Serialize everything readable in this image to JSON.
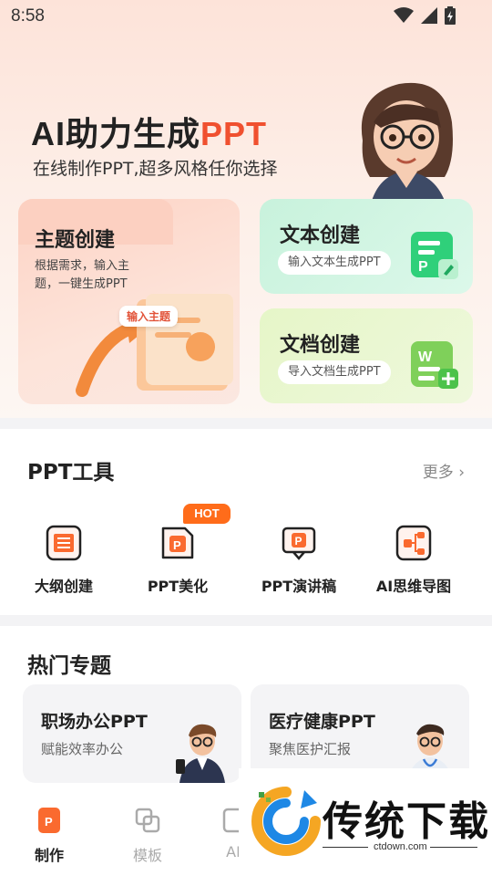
{
  "status_bar": {
    "time": "8:58"
  },
  "hero": {
    "title_prefix": "AI助力生成",
    "title_accent": "PPT",
    "subtitle": "在线制作PPT,超多风格任你选择"
  },
  "create_cards": {
    "theme": {
      "title": "主题创建",
      "description": "根据需求，输入主题，一键生成PPT",
      "tag": "输入主题"
    },
    "text": {
      "title": "文本创建",
      "button": "输入文本生成PPT"
    },
    "doc": {
      "title": "文档创建",
      "button": "导入文档生成PPT"
    }
  },
  "tools": {
    "title": "PPT工具",
    "more": "更多",
    "hot_badge": "HOT",
    "items": [
      {
        "label": "大纲创建",
        "icon": "outline-icon"
      },
      {
        "label": "PPT美化",
        "icon": "ppt-beautify-icon"
      },
      {
        "label": "PPT演讲稿",
        "icon": "ppt-speech-icon"
      },
      {
        "label": "AI思维导图",
        "icon": "mindmap-icon"
      }
    ]
  },
  "topics": {
    "title": "热门专题",
    "items": [
      {
        "title": "职场办公PPT",
        "subtitle": "赋能效率办公"
      },
      {
        "title": "医疗健康PPT",
        "subtitle": "聚焦医护汇报"
      }
    ]
  },
  "bottom_nav": {
    "items": [
      {
        "label": "制作",
        "active": true
      },
      {
        "label": "模板",
        "active": false
      },
      {
        "label": "AI",
        "active": false
      }
    ]
  },
  "watermark": {
    "text": "传统下载",
    "url": "ctdown.com"
  },
  "colors": {
    "accent": "#f0502f",
    "hot": "#ff6c1a",
    "green": "#2ecc71",
    "active_nav": "#222222",
    "inactive_nav": "#aaaaaa"
  }
}
